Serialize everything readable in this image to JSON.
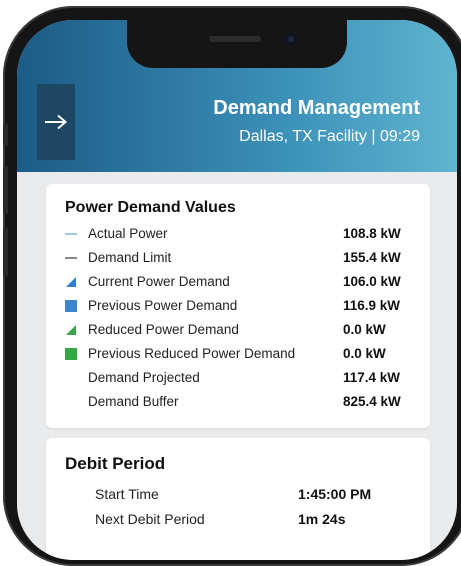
{
  "header": {
    "title": "Demand Management",
    "subtitle": "Dallas, TX Facility | 09:29",
    "back_icon": "arrow-right-icon"
  },
  "power_demand": {
    "title": "Power Demand Values",
    "items": [
      {
        "label": "Actual Power",
        "value": "108.8 kW",
        "icon": "line-light-blue",
        "color": "#8ab8d8"
      },
      {
        "label": "Demand Limit",
        "value": "155.4 kW",
        "icon": "line-gray",
        "color": "#6b6b6b"
      },
      {
        "label": "Current Power Demand",
        "value": "106.0 kW",
        "icon": "triangle-blue",
        "color": "#2f7fd0"
      },
      {
        "label": "Previous Power Demand",
        "value": "116.9 kW",
        "icon": "square-blue",
        "color": "#3d86c9"
      },
      {
        "label": "Reduced Power Demand",
        "value": "0.0 kW",
        "icon": "triangle-green",
        "color": "#3aa64a"
      },
      {
        "label": "Previous Reduced Power Demand",
        "value": "0.0 kW",
        "icon": "square-green",
        "color": "#35a844"
      },
      {
        "label": "Demand Projected",
        "value": "117.4 kW",
        "icon": "none"
      },
      {
        "label": "Demand Buffer",
        "value": "825.4 kW",
        "icon": "none"
      }
    ]
  },
  "debit_period": {
    "title": "Debit Period",
    "items": [
      {
        "label": "Start Time",
        "value": "1:45:00 PM"
      },
      {
        "label": "Next Debit Period",
        "value": "1m 24s"
      }
    ]
  }
}
